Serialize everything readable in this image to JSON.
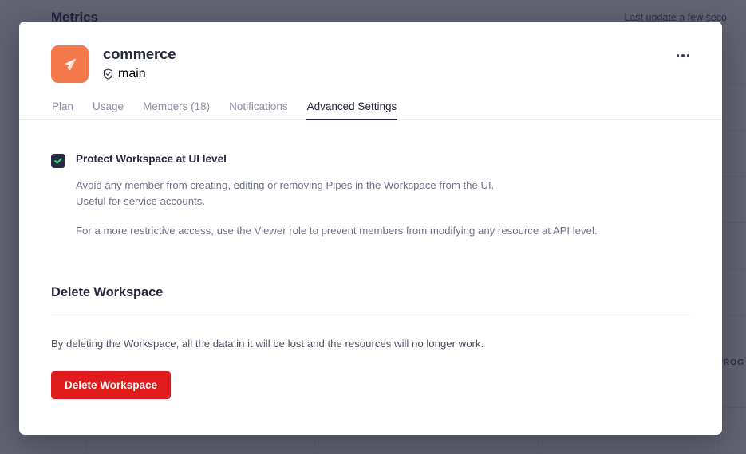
{
  "backdrop": {
    "page_title": "Metrics",
    "last_update": "Last update a few seco",
    "progress_label": "PROG"
  },
  "modal": {
    "workspace": {
      "avatar_icon": "paper-plane-logo-icon",
      "avatar_color": "#f4794b",
      "name": "commerce",
      "branch_icon": "shield-check-icon",
      "branch": "main"
    },
    "kebab_menu": {
      "icon": "ellipsis-horizontal-icon",
      "label": "..."
    },
    "tabs": [
      {
        "id": "plan",
        "label": "Plan",
        "active": false
      },
      {
        "id": "usage",
        "label": "Usage",
        "active": false
      },
      {
        "id": "members",
        "label": "Members (18)",
        "active": false
      },
      {
        "id": "notifications",
        "label": "Notifications",
        "active": false
      },
      {
        "id": "advanced-settings",
        "label": "Advanced Settings",
        "active": true
      }
    ],
    "advanced_settings": {
      "protect": {
        "checked": true,
        "checkbox_bg": "#262b42",
        "check_color": "#3ddc84",
        "label": "Protect Workspace at UI level",
        "description_line_1": "Avoid any member from creating, editing or removing Pipes in the Workspace from the UI.",
        "description_line_2": "Useful for service accounts.",
        "description_line_3": "For a more restrictive access, use the Viewer role to prevent members from modifying any resource at API level."
      },
      "delete": {
        "heading": "Delete Workspace",
        "description": "By deleting the Workspace, all the data in it will be lost and the resources will no longer work.",
        "button_label": "Delete Workspace",
        "button_color": "#e01b1b"
      }
    }
  }
}
